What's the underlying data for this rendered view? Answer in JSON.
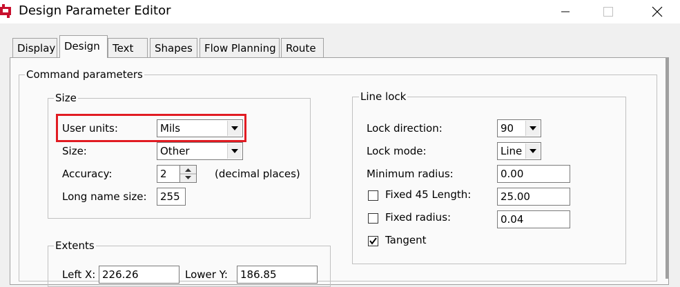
{
  "window": {
    "title": "Design Parameter Editor",
    "controls": [
      "minimize",
      "maximize",
      "close"
    ]
  },
  "tabs": [
    {
      "label": "Display",
      "active": false
    },
    {
      "label": "Design",
      "active": true
    },
    {
      "label": "Text",
      "active": false
    },
    {
      "label": "Shapes",
      "active": false
    },
    {
      "label": "Flow Planning",
      "active": false
    },
    {
      "label": "Route",
      "active": false
    }
  ],
  "command_parameters": {
    "title": "Command parameters",
    "size_group": {
      "title": "Size",
      "user_units": {
        "label": "User units:",
        "value": "Mils"
      },
      "size": {
        "label": "Size:",
        "value": "Other"
      },
      "accuracy": {
        "label": "Accuracy:",
        "value": "2",
        "suffix": "(decimal places)"
      },
      "long_name_size": {
        "label": "Long name size:",
        "value": "255"
      }
    },
    "extents_group": {
      "title": "Extents",
      "left_x": {
        "label": "Left X:",
        "value": "226.26"
      },
      "lower_y": {
        "label": "Lower Y:",
        "value": "186.85"
      }
    },
    "line_lock_group": {
      "title": "Line lock",
      "lock_direction": {
        "label": "Lock direction:",
        "value": "90"
      },
      "lock_mode": {
        "label": "Lock mode:",
        "value": "Line"
      },
      "minimum_radius": {
        "label": "Minimum radius:",
        "value": "0.00"
      },
      "fixed_45_length": {
        "label": "Fixed 45 Length:",
        "value": "25.00",
        "checked": false
      },
      "fixed_radius": {
        "label": "Fixed radius:",
        "value": "0.04",
        "checked": false
      },
      "tangent": {
        "label": "Tangent",
        "checked": true
      }
    }
  },
  "highlight_color": "#e11b22"
}
